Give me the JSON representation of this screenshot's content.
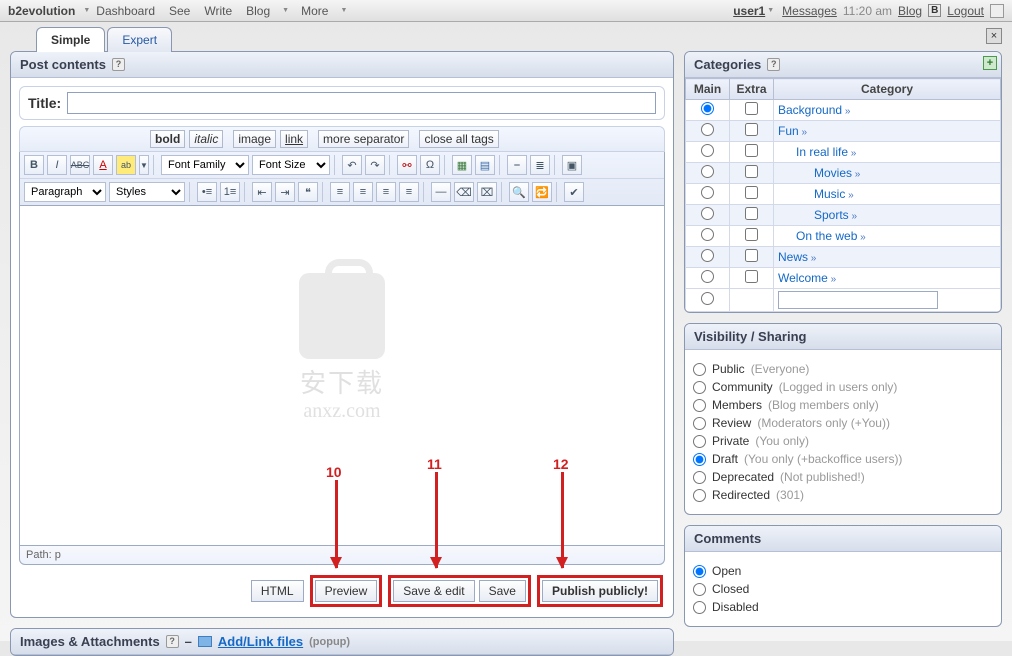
{
  "topbar": {
    "brand": "b2evolution",
    "left": [
      "Dashboard",
      "See",
      "Write",
      "Blog",
      "More"
    ],
    "user": "user1",
    "messages": "Messages",
    "time": "11:20 am",
    "blog": "Blog",
    "logout": "Logout"
  },
  "tabs": {
    "simple": "Simple",
    "expert": "Expert"
  },
  "post": {
    "panel_title": "Post contents",
    "title_label": "Title:",
    "title_value": "",
    "quicktags": {
      "bold": "bold",
      "italic": "italic",
      "image": "image",
      "link": "link",
      "more": "more",
      "separator": "separator",
      "close": "close all tags"
    },
    "mce": {
      "font_family": "Font Family",
      "font_size": "Font Size",
      "paragraph": "Paragraph",
      "styles": "Styles",
      "b": "B",
      "i": "I",
      "abc": "ABC",
      "a": "A"
    },
    "watermark": {
      "cn": "安下载",
      "en": "anxz.com"
    },
    "path": "Path: p",
    "actions": {
      "html": "HTML",
      "preview": "Preview",
      "save_edit": "Save & edit",
      "save": "Save",
      "publish": "Publish publicly!"
    }
  },
  "images_panel": {
    "title": "Images & Attachments",
    "addlink": "Add/Link files",
    "popup": "(popup)"
  },
  "categories": {
    "title": "Categories",
    "headers": {
      "main": "Main",
      "extra": "Extra",
      "category": "Category"
    },
    "rows": [
      {
        "label": "Background",
        "indent": 0,
        "main": true,
        "band": false
      },
      {
        "label": "Fun",
        "indent": 0,
        "main": false,
        "band": true
      },
      {
        "label": "In real life",
        "indent": 1,
        "main": false,
        "band": false
      },
      {
        "label": "Movies",
        "indent": 2,
        "main": false,
        "band": true
      },
      {
        "label": "Music",
        "indent": 2,
        "main": false,
        "band": false
      },
      {
        "label": "Sports",
        "indent": 2,
        "main": false,
        "band": true
      },
      {
        "label": "On the web",
        "indent": 1,
        "main": false,
        "band": false
      },
      {
        "label": "News",
        "indent": 0,
        "main": false,
        "band": true
      },
      {
        "label": "Welcome",
        "indent": 0,
        "main": false,
        "band": false
      }
    ]
  },
  "visibility": {
    "title": "Visibility / Sharing",
    "items": [
      {
        "label": "Public",
        "hint": "(Everyone)",
        "checked": false
      },
      {
        "label": "Community",
        "hint": "(Logged in users only)",
        "checked": false
      },
      {
        "label": "Members",
        "hint": "(Blog members only)",
        "checked": false
      },
      {
        "label": "Review",
        "hint": "(Moderators only (+You))",
        "checked": false
      },
      {
        "label": "Private",
        "hint": "(You only)",
        "checked": false
      },
      {
        "label": "Draft",
        "hint": "(You only (+backoffice users))",
        "checked": true
      },
      {
        "label": "Deprecated",
        "hint": "(Not published!)",
        "checked": false
      },
      {
        "label": "Redirected",
        "hint": "(301)",
        "checked": false
      }
    ]
  },
  "comments": {
    "title": "Comments",
    "items": [
      {
        "label": "Open",
        "checked": true
      },
      {
        "label": "Closed",
        "checked": false
      },
      {
        "label": "Disabled",
        "checked": false
      }
    ]
  },
  "annotations": {
    "n10": "10",
    "n11": "11",
    "n12": "12"
  }
}
